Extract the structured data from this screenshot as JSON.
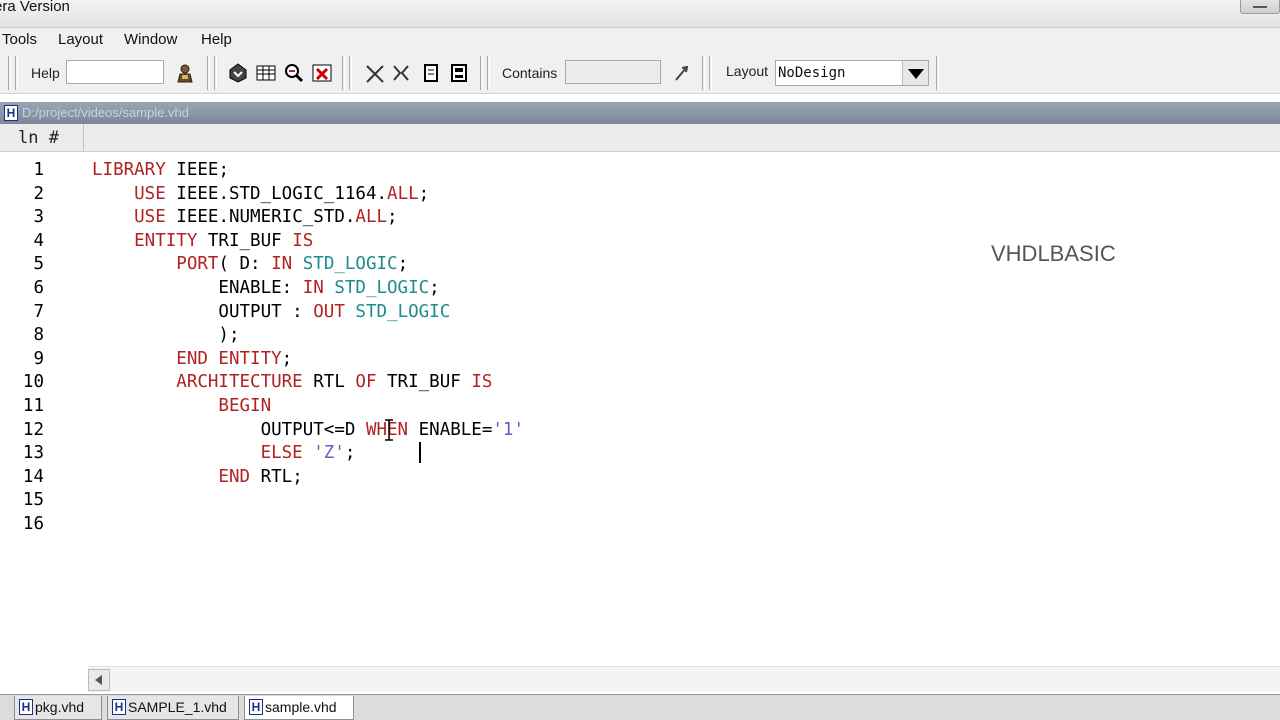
{
  "window": {
    "title": "era Version"
  },
  "menu": [
    "Tools",
    "Layout",
    "Window",
    "Help"
  ],
  "toolbar": {
    "help_label": "Help",
    "help_value": "",
    "contains_label": "Contains",
    "contains_value": "",
    "layout_label": "Layout",
    "layout_value": "NoDesign",
    "icons": [
      "search-person-icon",
      "compile-icon",
      "simulate-icon",
      "wave-icon",
      "stop-icon",
      "cut-icon",
      "copy-icon",
      "paste-icon",
      "save-icon",
      "find-next-icon"
    ]
  },
  "document": {
    "path": "D:/project/videos/sample.vhd",
    "line_header": "ln #"
  },
  "code": {
    "lines": [
      {
        "n": "1",
        "tokens": [
          {
            "t": "LIBRARY",
            "c": "kw"
          },
          {
            "t": " IEEE;",
            "c": "id"
          }
        ]
      },
      {
        "n": "2",
        "tokens": [
          {
            "t": "    USE",
            "c": "kw"
          },
          {
            "t": " IEEE.STD_LOGIC_1164.",
            "c": "id"
          },
          {
            "t": "ALL",
            "c": "kw"
          },
          {
            "t": ";",
            "c": "id"
          }
        ]
      },
      {
        "n": "3",
        "tokens": [
          {
            "t": "    USE",
            "c": "kw"
          },
          {
            "t": " IEEE.NUMERIC_STD.",
            "c": "id"
          },
          {
            "t": "ALL",
            "c": "kw"
          },
          {
            "t": ";",
            "c": "id"
          }
        ]
      },
      {
        "n": "4",
        "tokens": [
          {
            "t": "    ENTITY",
            "c": "kw"
          },
          {
            "t": " TRI_BUF ",
            "c": "id"
          },
          {
            "t": "IS",
            "c": "kw"
          }
        ]
      },
      {
        "n": "5",
        "tokens": [
          {
            "t": "        PORT",
            "c": "kw"
          },
          {
            "t": "( D: ",
            "c": "id"
          },
          {
            "t": "IN",
            "c": "kw"
          },
          {
            "t": " ",
            "c": "id"
          },
          {
            "t": "STD_LOGIC",
            "c": "ty"
          },
          {
            "t": ";",
            "c": "id"
          }
        ]
      },
      {
        "n": "6",
        "tokens": [
          {
            "t": "            ENABLE: ",
            "c": "id"
          },
          {
            "t": "IN",
            "c": "kw"
          },
          {
            "t": " ",
            "c": "id"
          },
          {
            "t": "STD_LOGIC",
            "c": "ty"
          },
          {
            "t": ";",
            "c": "id"
          }
        ]
      },
      {
        "n": "7",
        "tokens": [
          {
            "t": "            OUTPUT : ",
            "c": "id"
          },
          {
            "t": "OUT",
            "c": "kw"
          },
          {
            "t": " ",
            "c": "id"
          },
          {
            "t": "STD_LOGIC",
            "c": "ty"
          }
        ]
      },
      {
        "n": "8",
        "tokens": [
          {
            "t": "            );",
            "c": "id"
          }
        ]
      },
      {
        "n": "9",
        "tokens": [
          {
            "t": "        END ENTITY",
            "c": "kw"
          },
          {
            "t": ";",
            "c": "id"
          }
        ]
      },
      {
        "n": "10",
        "tokens": [
          {
            "t": "        ARCHITECTURE",
            "c": "kw"
          },
          {
            "t": " RTL ",
            "c": "id"
          },
          {
            "t": "OF",
            "c": "kw"
          },
          {
            "t": " TRI_BUF ",
            "c": "id"
          },
          {
            "t": "IS",
            "c": "kw"
          }
        ]
      },
      {
        "n": "11",
        "tokens": [
          {
            "t": "            BEGIN",
            "c": "kw"
          }
        ]
      },
      {
        "n": "12",
        "tokens": [
          {
            "t": "                OUTPUT<=D ",
            "c": "id"
          },
          {
            "t": "WHEN",
            "c": "kw"
          },
          {
            "t": " ENABLE=",
            "c": "id"
          },
          {
            "t": "'1'",
            "c": "st"
          }
        ]
      },
      {
        "n": "13",
        "tokens": [
          {
            "t": "                ELSE",
            "c": "kw"
          },
          {
            "t": " ",
            "c": "id"
          },
          {
            "t": "'Z'",
            "c": "st"
          },
          {
            "t": ";",
            "c": "id"
          }
        ]
      },
      {
        "n": "14",
        "tokens": [
          {
            "t": "            END",
            "c": "kw"
          },
          {
            "t": " RTL;",
            "c": "id"
          }
        ]
      },
      {
        "n": "15",
        "tokens": []
      },
      {
        "n": "16",
        "tokens": []
      }
    ]
  },
  "overlay": {
    "watermark": "VHDLBASIC"
  },
  "tabs": [
    {
      "label": "pkg.vhd",
      "active": false
    },
    {
      "label": "SAMPLE_1.vhd",
      "active": false
    },
    {
      "label": "sample.vhd",
      "active": true
    }
  ],
  "colors": {
    "keyword": "#b22222",
    "type": "#1f8b8b",
    "string": "#6a5acd"
  }
}
